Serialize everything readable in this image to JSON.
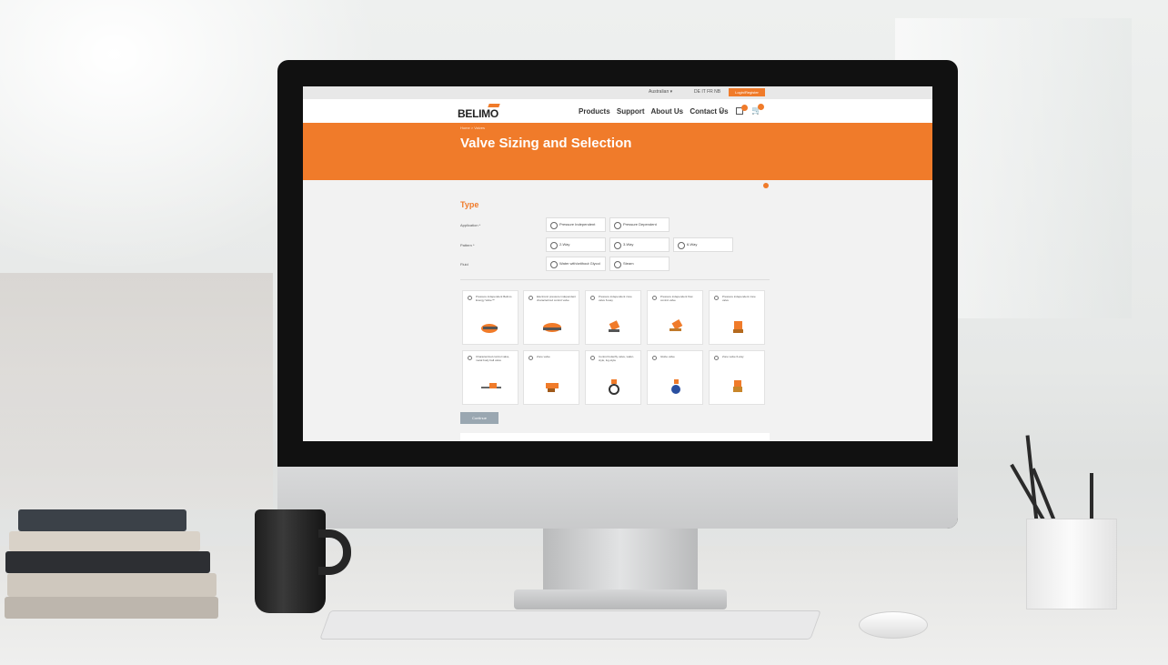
{
  "site": {
    "topbar": {
      "language": "Australian ▾",
      "codes": "DE  IT  FR  NB",
      "login": "Login/Register"
    },
    "logo": "BELIMO",
    "nav": [
      "Products",
      "Support",
      "About Us",
      "Contact Us"
    ],
    "breadcrumb": "Home > Valves",
    "hero_title": "Valve Sizing and Selection",
    "type_section": {
      "title": "Type",
      "rows": [
        {
          "label": "Application *",
          "options": [
            "Pressure Independent",
            "Pressure Dependent"
          ]
        },
        {
          "label": "Pattern *",
          "options": [
            "2-Way",
            "3-Way",
            "6-Way"
          ]
        },
        {
          "label": "Fluid",
          "options": [
            "Water with/without Glycol",
            "Steam"
          ]
        }
      ]
    },
    "products": [
      "Pressure independent Belimo Energy Valve™",
      "Electronic pressure independent characterized control valve",
      "Pressure independent zone valve 6-way",
      "Pressure independent flow control valve",
      "Pressure independent zone valve",
      "Characterized control valve, metal body ball valve",
      "Zone valve",
      "Control butterfly valve, wafer-style, lug-style",
      "Globe valve",
      "Zone valve 6-way"
    ],
    "continue_label": "Continue"
  },
  "colors": {
    "accent": "#f07b2a",
    "button": "#9aa7b1"
  }
}
